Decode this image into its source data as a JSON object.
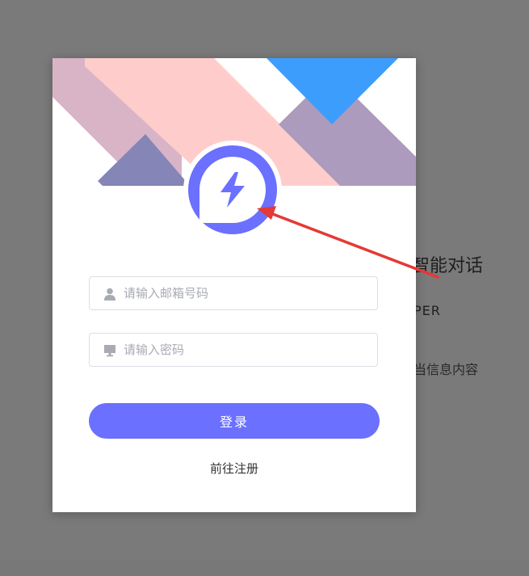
{
  "background": {
    "title": "智能对话",
    "subtitle": "PER",
    "description": "当信息内容"
  },
  "login": {
    "email_placeholder": "请输入邮箱号码",
    "password_placeholder": "请输入密码",
    "login_button": "登录",
    "register_link": "前往注册"
  },
  "icons": {
    "logo": "lightning-chat-icon",
    "email": "user-icon",
    "password": "monitor-icon"
  },
  "colors": {
    "accent": "#6b70ff",
    "annotation_arrow": "#e53935"
  }
}
